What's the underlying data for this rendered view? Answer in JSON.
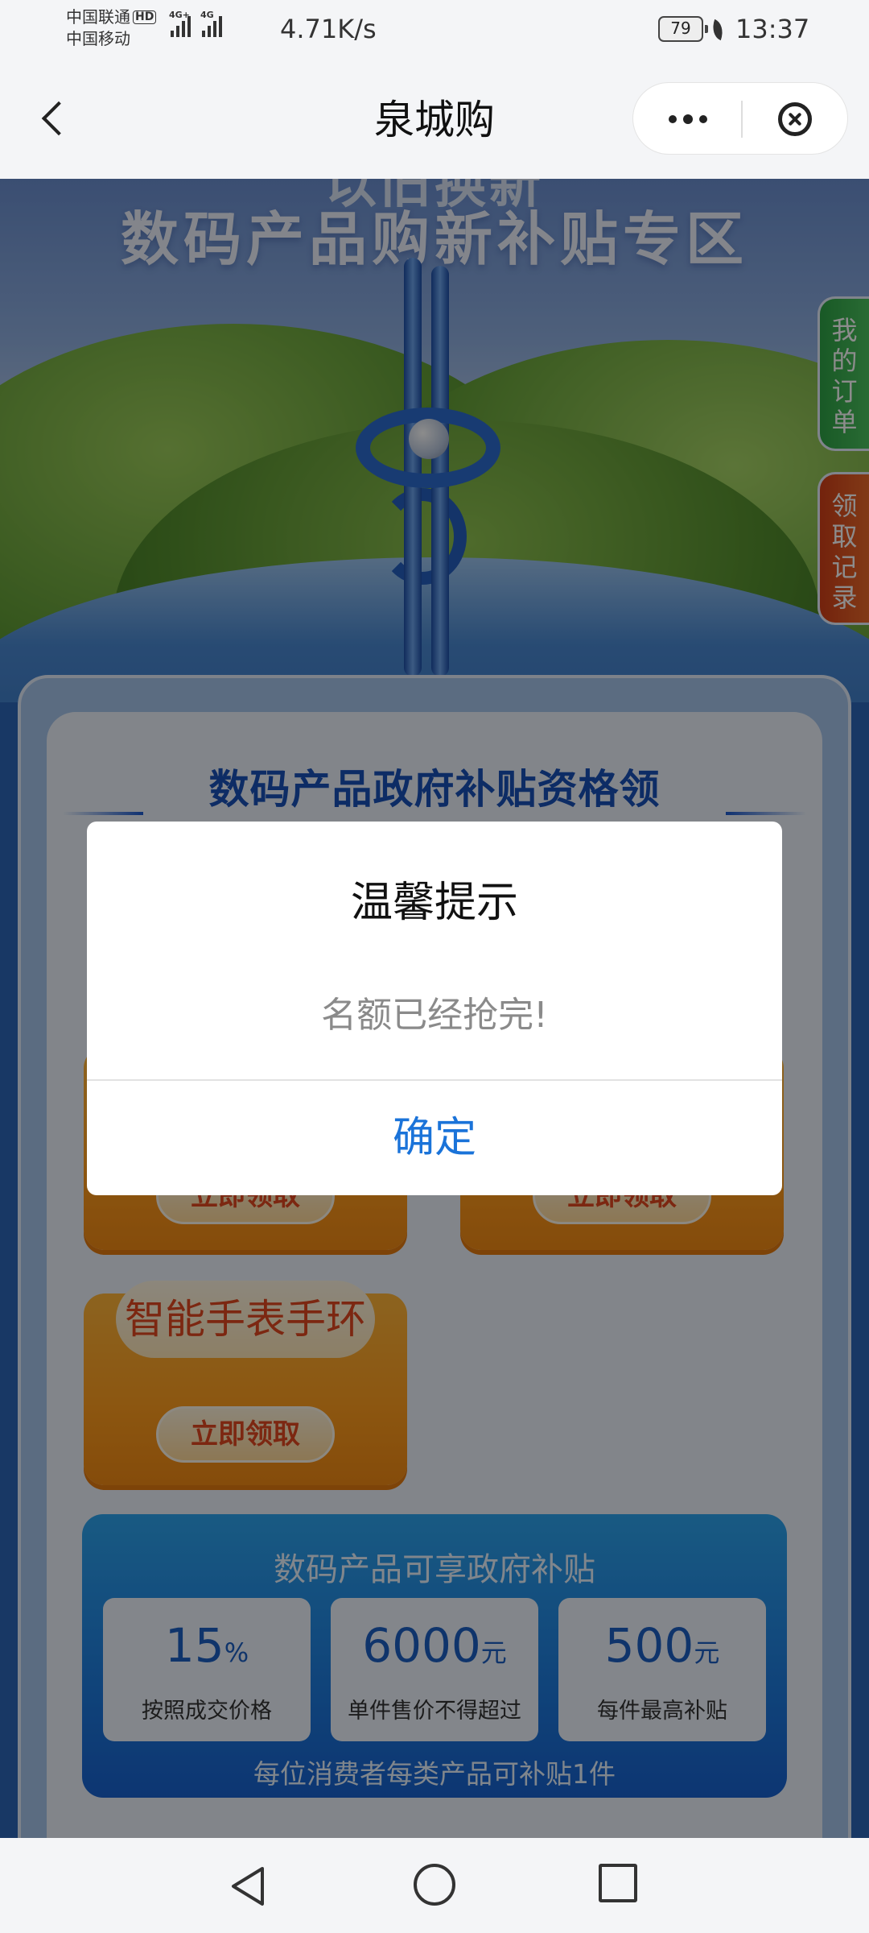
{
  "status_bar": {
    "carrier_1": "中国联通",
    "carrier_2": "中国移动",
    "hd_badge": "HD",
    "sim1_gen": "4G+",
    "sim2_gen": "4G",
    "net_speed": "4.71K/s",
    "battery": "79",
    "time": "13:37"
  },
  "nav": {
    "title": "泉城购",
    "back_icon": "chevron-left-icon",
    "more_icon": "more-dots-icon",
    "close_icon": "close-circle-icon"
  },
  "hero": {
    "cut_title": "以旧换新",
    "title": "数码产品购新补贴专区",
    "side_tabs": [
      "我的订单",
      "领取记录"
    ]
  },
  "section": {
    "title": "数码产品政府补贴资格领"
  },
  "coupons": {
    "c_label": "智能手表手环",
    "claim_label": "立即领取"
  },
  "subsidy": {
    "title": "数码产品可享政府补贴",
    "stats": [
      {
        "value": "15",
        "unit": "%",
        "desc": "按照成交价格"
      },
      {
        "value": "6000",
        "unit": "元",
        "desc": "单件售价不得超过"
      },
      {
        "value": "500",
        "unit": "元",
        "desc": "每件最高补贴"
      }
    ],
    "note": "每位消费者每类产品可补贴1件"
  },
  "dialog": {
    "title": "温馨提示",
    "message": "名额已经抢完!",
    "confirm_label": "确定"
  },
  "colors": {
    "accent_blue": "#1a73d9",
    "coupon_orange": "#ff9d1e",
    "tab_green": "#2ea346",
    "tab_red": "#d23f18"
  }
}
